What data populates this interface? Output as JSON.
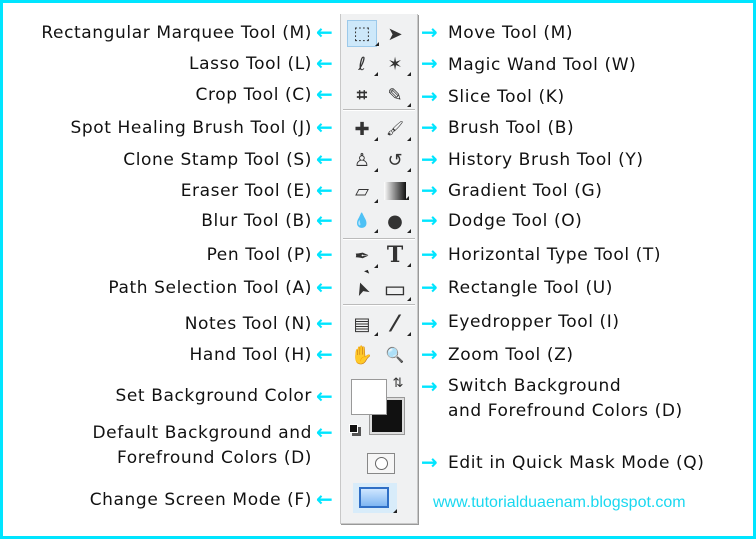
{
  "left_labels": [
    "Rectangular Marquee Tool (M)",
    "Lasso Tool (L)",
    "Crop Tool (C)",
    "Spot Healing Brush Tool (J)",
    "Clone Stamp Tool (S)",
    "Eraser Tool (E)",
    "Blur Tool (B)",
    "Pen Tool (P)",
    "Path Selection Tool (A)",
    "Notes Tool (N)",
    "Hand Tool (H)",
    "Set Background Color",
    "Default Background and",
    "Forefround Colors (D)",
    "Change Screen Mode (F)"
  ],
  "right_labels": [
    "Move Tool (M)",
    "Magic Wand Tool (W)",
    "Slice Tool (K)",
    "Brush Tool (B)",
    "History Brush Tool (Y)",
    "Gradient Tool (G)",
    "Dodge Tool (O)",
    "Horizontal Type Tool (T)",
    "Rectangle Tool (U)",
    "Eyedropper Tool (I)",
    "Zoom Tool (Z)",
    "Switch Background",
    "and Forefround Colors (D)",
    "Edit in Quick Mask Mode (Q)"
  ],
  "arrows": {
    "left": "←",
    "right": "→"
  },
  "icons": {
    "marquee": "⬚",
    "move": "➤",
    "lasso": "ℓ",
    "wand": "✶",
    "crop": "⌗",
    "slice": "✎",
    "heal": "✚",
    "brush": "🖌",
    "stamp": "♙",
    "history": "↺",
    "eraser": "▱",
    "gradient": "▬",
    "blur": "💧",
    "dodge": "●",
    "pen": "✒",
    "type": "T",
    "path": "➤",
    "rect": "▭",
    "notes": "▤",
    "eyedropper": "⁄",
    "hand": "✋",
    "zoom": "🔍",
    "swap": "⇅"
  },
  "website": "www.tutorialduaenam.blogspot.com",
  "colors": {
    "accent": "#00e5ff",
    "url": "#1ad8f0"
  }
}
